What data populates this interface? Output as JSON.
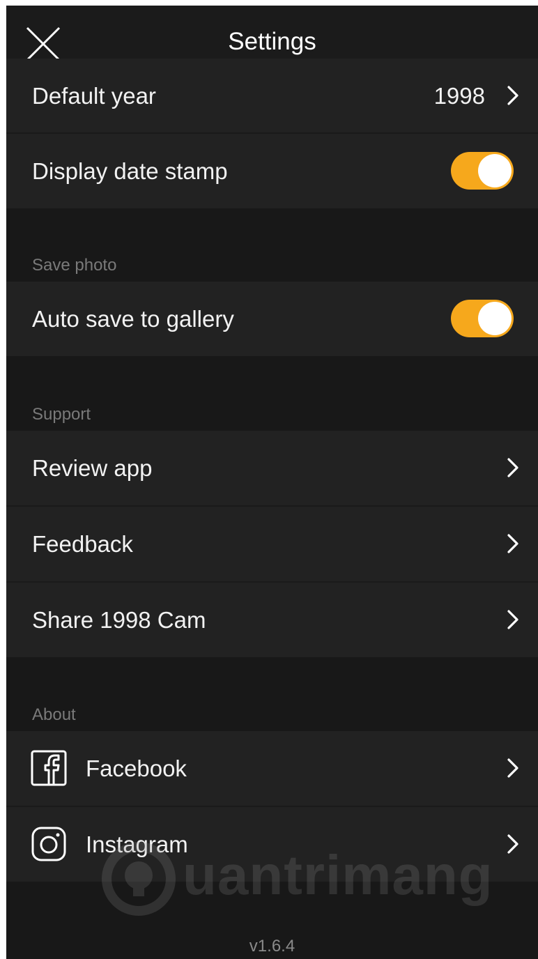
{
  "nav": {
    "title": "Settings",
    "close_icon": "close-icon"
  },
  "rows": {
    "default_year": {
      "label": "Default year",
      "value": "1998"
    },
    "display_date_stamp": {
      "label": "Display date stamp",
      "toggle_on": true
    },
    "auto_save": {
      "label": "Auto save to gallery",
      "toggle_on": true
    },
    "review_app": {
      "label": "Review app"
    },
    "feedback": {
      "label": "Feedback"
    },
    "share": {
      "label": "Share 1998 Cam"
    },
    "facebook": {
      "label": "Facebook",
      "icon": "facebook-icon"
    },
    "instagram": {
      "label": "Instagram",
      "icon": "instagram-icon"
    }
  },
  "sections": {
    "save_photo": "Save photo",
    "support": "Support",
    "about": "About"
  },
  "footer": {
    "version": "v1.6.4"
  },
  "watermark": {
    "text": "uantrimang"
  },
  "colors": {
    "toggle_on": "#f6a81c",
    "row_background": "#222222",
    "screen_background": "#181818",
    "section_header": "#7a7a7a"
  }
}
